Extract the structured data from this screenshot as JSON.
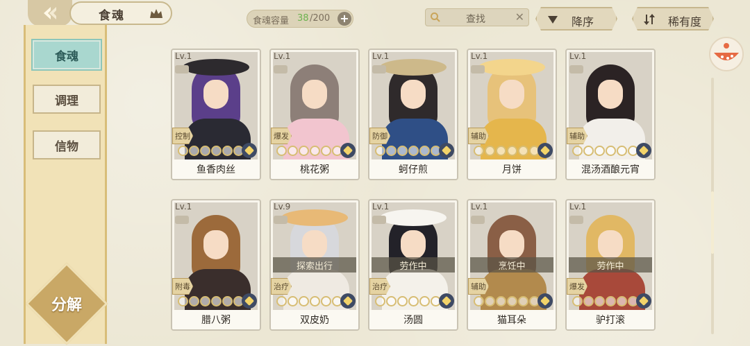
{
  "header": {
    "title": "食魂",
    "capacity": {
      "label": "食魂容量",
      "current": "38",
      "max": "/200",
      "add_symbol": "+"
    },
    "search": {
      "text": "查找",
      "clear_symbol": "✕"
    },
    "sort_label": "降序",
    "rarity_label": "稀有度"
  },
  "sidebar": {
    "items": [
      {
        "label": "食魂",
        "active": true
      },
      {
        "label": "调理",
        "active": false
      },
      {
        "label": "信物",
        "active": false
      }
    ],
    "decompose_label": "分解"
  },
  "cards": [
    {
      "level": "Lv.1",
      "role": "控制",
      "name": "鱼香肉丝",
      "status": "",
      "stars": 0,
      "hair": "#5b3f8a",
      "body": "#2a2a33",
      "hat": "#2d2a2e"
    },
    {
      "level": "Lv.1",
      "role": "爆发",
      "name": "桃花粥",
      "status": "",
      "stars": 0,
      "hair": "#8d7f78",
      "body": "#f2c5cf",
      "hat": ""
    },
    {
      "level": "Lv.1",
      "role": "防御",
      "name": "蚵仔煎",
      "status": "",
      "stars": 0,
      "hair": "#2f2a2b",
      "body": "#2f4f86",
      "hat": "#cdb98a"
    },
    {
      "level": "Lv.1",
      "role": "辅助",
      "name": "月饼",
      "status": "",
      "stars": 0,
      "hair": "#e7c27a",
      "body": "#e5b64c",
      "hat": "#f3d58c"
    },
    {
      "level": "Lv.1",
      "role": "辅助",
      "name": "混汤酒酿元宵",
      "status": "",
      "stars": 0,
      "hair": "#2b2324",
      "body": "#f2efea",
      "hat": ""
    },
    {
      "level": "Lv.1",
      "role": "附毒",
      "name": "腊八粥",
      "status": "",
      "stars": 0,
      "hair": "#9c6a3b",
      "body": "#3a2e2c",
      "hat": ""
    },
    {
      "level": "Lv.9",
      "role": "治疗",
      "name": "双皮奶",
      "status": "探索出行",
      "stars": 0,
      "hair": "#d7d8dc",
      "body": "#efeae2",
      "hat": "#e8b976"
    },
    {
      "level": "Lv.1",
      "role": "治疗",
      "name": "汤圆",
      "status": "劳作中",
      "stars": 0,
      "hair": "#232229",
      "body": "#f4f1ea",
      "hat": "#f7f5f0"
    },
    {
      "level": "Lv.1",
      "role": "辅助",
      "name": "猫耳朵",
      "status": "烹饪中",
      "stars": 0,
      "hair": "#8a5f46",
      "body": "#b28a4d",
      "hat": ""
    },
    {
      "level": "Lv.1",
      "role": "爆发",
      "name": "驴打滚",
      "status": "劳作中",
      "stars": 0,
      "hair": "#e1b864",
      "body": "#a8493a",
      "hat": ""
    }
  ]
}
